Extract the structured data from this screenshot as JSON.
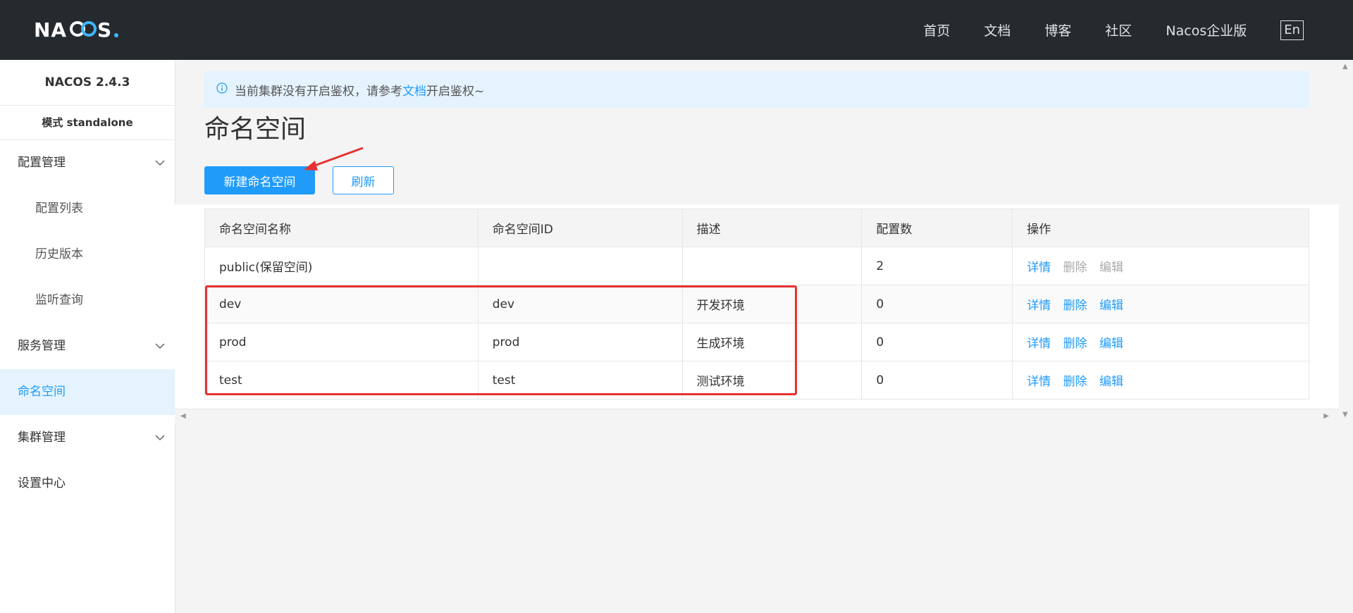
{
  "header": {
    "logo_text": "NACOS.",
    "nav": [
      "首页",
      "文档",
      "博客",
      "社区",
      "Nacos企业版"
    ],
    "lang": "En"
  },
  "sidebar": {
    "version": "NACOS 2.4.3",
    "mode": "模式 standalone",
    "items": [
      {
        "label": "配置管理",
        "expandable": true
      },
      {
        "label": "配置列表"
      },
      {
        "label": "历史版本"
      },
      {
        "label": "监听查询"
      },
      {
        "label": "服务管理",
        "expandable": true
      },
      {
        "label": "命名空间",
        "active": true
      },
      {
        "label": "集群管理",
        "expandable": true
      },
      {
        "label": "设置中心"
      }
    ]
  },
  "notice": {
    "text_before": "当前集群没有开启鉴权，请参考",
    "link": "文档",
    "text_after": "开启鉴权~"
  },
  "page": {
    "title": "命名空间",
    "create_button": "新建命名空间",
    "refresh_button": "刷新"
  },
  "table": {
    "columns": [
      "命名空间名称",
      "命名空间ID",
      "描述",
      "配置数",
      "操作"
    ],
    "rows": [
      {
        "name": "public(保留空间)",
        "id": "",
        "desc": "",
        "count": "2",
        "ops": [
          "详情",
          "删除",
          "编辑"
        ],
        "ops_enabled": [
          true,
          false,
          false
        ]
      },
      {
        "name": "dev",
        "id": "dev",
        "desc": "开发环境",
        "count": "0",
        "ops": [
          "详情",
          "删除",
          "编辑"
        ],
        "ops_enabled": [
          true,
          true,
          true
        ]
      },
      {
        "name": "prod",
        "id": "prod",
        "desc": "生成环境",
        "count": "0",
        "ops": [
          "详情",
          "删除",
          "编辑"
        ],
        "ops_enabled": [
          true,
          true,
          true
        ]
      },
      {
        "name": "test",
        "id": "test",
        "desc": "测试环境",
        "count": "0",
        "ops": [
          "详情",
          "删除",
          "编辑"
        ],
        "ops_enabled": [
          true,
          true,
          true
        ]
      }
    ]
  },
  "colors": {
    "header_bg": "#252a2f",
    "accent": "#209bfa",
    "annotation": "#e63232"
  }
}
